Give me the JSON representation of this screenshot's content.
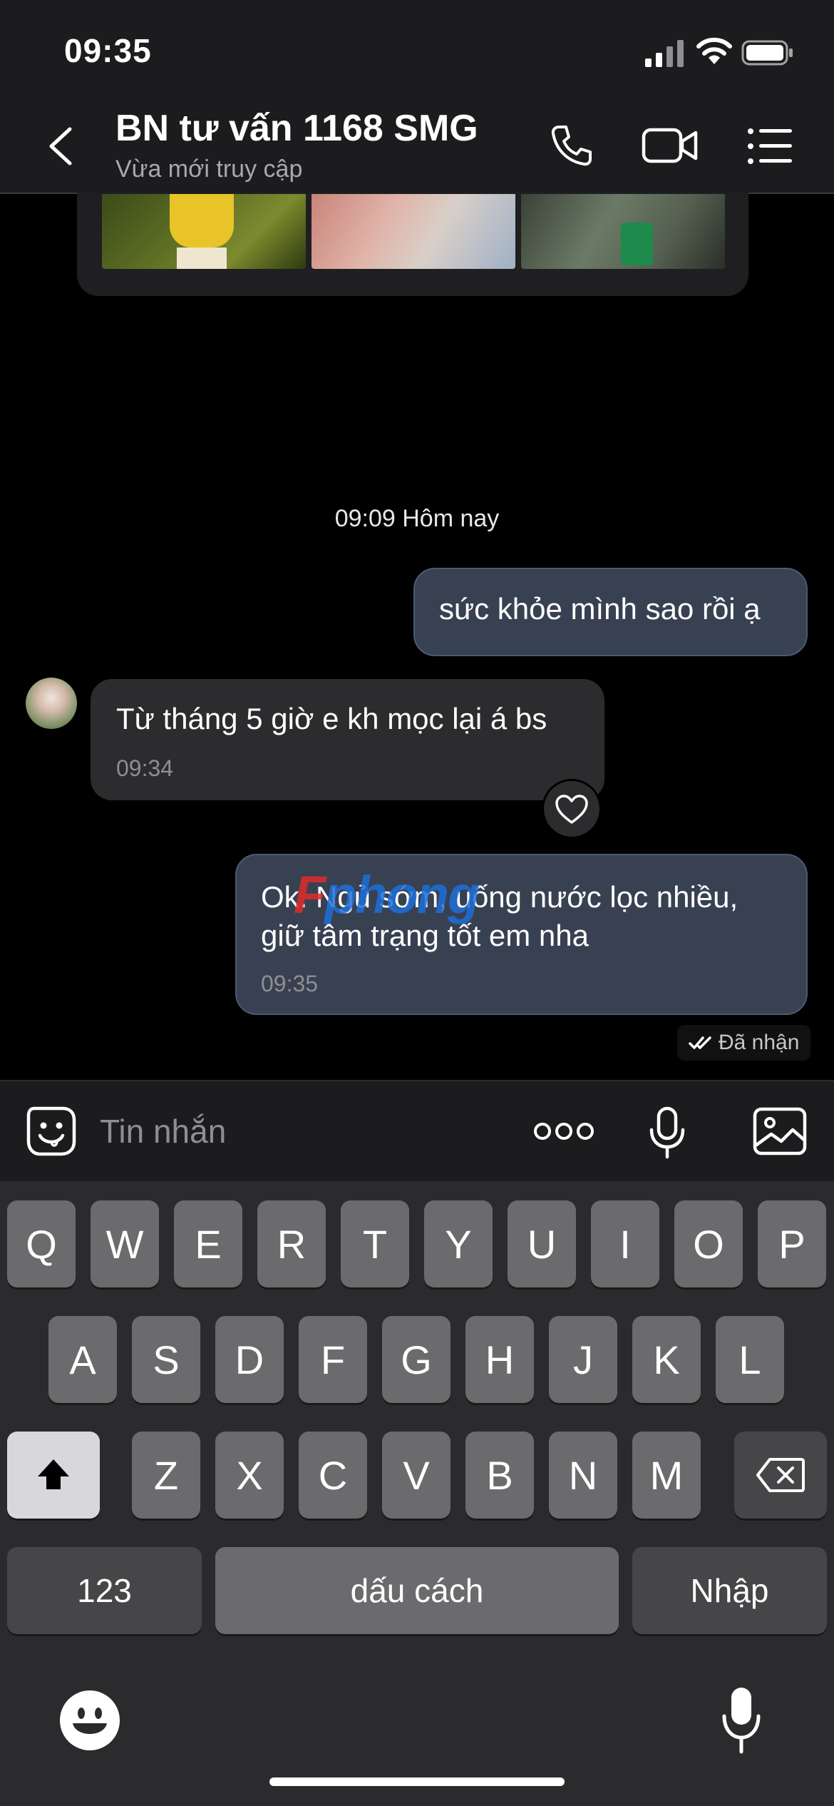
{
  "status_bar": {
    "time": "09:35",
    "icons": [
      "cellular-signal-icon",
      "wifi-icon",
      "battery-icon"
    ]
  },
  "header": {
    "title": "BN tư vấn 1168 SMG",
    "subtitle": "Vừa mới truy cập",
    "icons": [
      "back-chevron-icon",
      "phone-icon",
      "video-call-icon",
      "menu-list-icon"
    ]
  },
  "chat": {
    "time_separator": "09:09 Hôm nay",
    "messages": [
      {
        "direction": "outgoing",
        "text": "sức khỏe mình sao rồi ạ",
        "time": ""
      },
      {
        "direction": "incoming",
        "text": "Từ tháng 5 giờ e kh mọc lại á bs",
        "time": "09:34"
      },
      {
        "direction": "outgoing",
        "text": "Ok. Ngủ sớm, uống nước lọc nhiều, giữ tâm trạng tốt em nha",
        "time": "09:35"
      }
    ],
    "delivered_status": "Đã nhận",
    "watermark": {
      "part1": "F",
      "part2": "phong"
    }
  },
  "input_bar": {
    "placeholder": "Tin nhắn",
    "icons": [
      "emoji-sticker-icon",
      "more-dots-icon",
      "microphone-icon",
      "image-gallery-icon"
    ]
  },
  "keyboard": {
    "row1": [
      "Q",
      "W",
      "E",
      "R",
      "T",
      "Y",
      "U",
      "I",
      "O",
      "P"
    ],
    "row2": [
      "A",
      "S",
      "D",
      "F",
      "G",
      "H",
      "J",
      "K",
      "L"
    ],
    "row3": [
      "Z",
      "X",
      "C",
      "V",
      "B",
      "N",
      "M"
    ],
    "numbers_key": "123",
    "space_key": "dấu cách",
    "return_key": "Nhập",
    "icons": [
      "shift-arrow-icon",
      "backspace-icon",
      "emoji-keyboard-icon",
      "dictation-mic-icon"
    ]
  },
  "colors": {
    "background": "#000000",
    "bar": "#1c1c1e",
    "outgoing_bubble": "#384152",
    "incoming_bubble": "#2c2c2e",
    "keyboard": "#2b2b2d",
    "key": "#6b6b6e"
  }
}
